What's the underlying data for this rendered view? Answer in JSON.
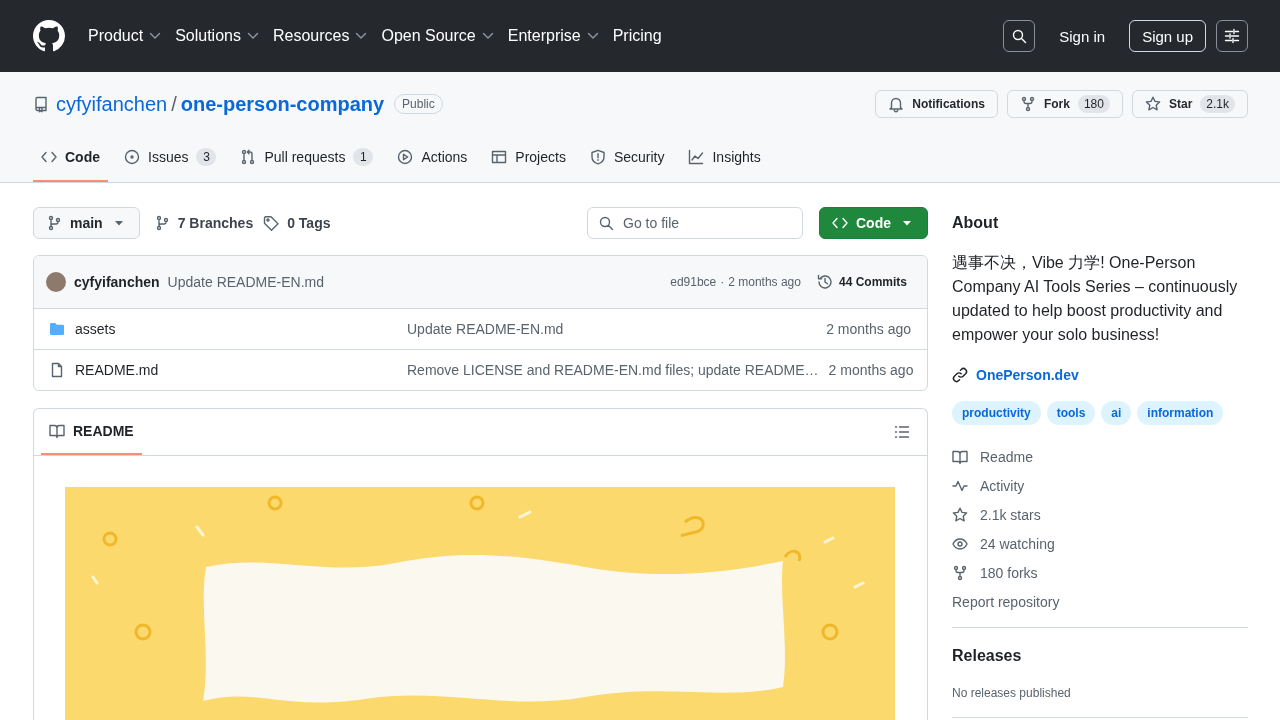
{
  "header": {
    "nav": [
      {
        "label": "Product",
        "dropdown": true
      },
      {
        "label": "Solutions",
        "dropdown": true
      },
      {
        "label": "Resources",
        "dropdown": true
      },
      {
        "label": "Open Source",
        "dropdown": true
      },
      {
        "label": "Enterprise",
        "dropdown": true
      },
      {
        "label": "Pricing",
        "dropdown": false
      }
    ],
    "sign_in": "Sign in",
    "sign_up": "Sign up"
  },
  "repo": {
    "owner": "cyfyifanchen",
    "separator": "/",
    "name": "one-person-company",
    "visibility": "Public",
    "actions": [
      {
        "kind": "notifications",
        "label": "Notifications"
      },
      {
        "kind": "fork",
        "label": "Fork",
        "count": "180"
      },
      {
        "kind": "star",
        "label": "Star",
        "count": "2.1k"
      }
    ]
  },
  "tabs": [
    {
      "kind": "code",
      "label": "Code",
      "selected": true
    },
    {
      "kind": "issues",
      "label": "Issues",
      "count": "3",
      "selected": false
    },
    {
      "kind": "pulls",
      "label": "Pull requests",
      "count": "1",
      "selected": false
    },
    {
      "kind": "actions",
      "label": "Actions",
      "selected": false
    },
    {
      "kind": "projects",
      "label": "Projects",
      "selected": false
    },
    {
      "kind": "security",
      "label": "Security",
      "selected": false
    },
    {
      "kind": "insights",
      "label": "Insights",
      "selected": false
    }
  ],
  "toolbar": {
    "branch": "main",
    "branches": "7 Branches",
    "tags": "0 Tags",
    "file_search": {
      "placeholder": "Go to file"
    },
    "code_button": "Code"
  },
  "latest_commit": {
    "author": "cyfyifanchen",
    "message": "Update README-EN.md",
    "hash": "ed91bce",
    "separator": "·",
    "age": "2 months ago",
    "commits": "44 Commits"
  },
  "files": [
    {
      "kind": "folder",
      "name": "assets",
      "message": "Update README-EN.md",
      "age": "2 months ago"
    },
    {
      "kind": "file",
      "name": "README.md",
      "message": "Remove LICENSE and README-EN.md files; update README…",
      "age": "2 months ago"
    }
  ],
  "readme": {
    "tab": "README"
  },
  "about": {
    "title": "About",
    "description": "遇事不决，Vibe 力学! One-Person Company AI Tools Series – continuously updated to help boost productivity and empower your solo business!",
    "website": "OnePerson.dev",
    "topics": [
      "productivity",
      "tools",
      "ai",
      "information"
    ],
    "links": [
      {
        "kind": "readme",
        "label": "Readme"
      },
      {
        "kind": "activity",
        "label": "Activity"
      },
      {
        "kind": "stars",
        "label": "2.1k stars"
      },
      {
        "kind": "watching",
        "label": "24 watching"
      },
      {
        "kind": "forks",
        "label": "180 forks"
      }
    ],
    "report": "Report repository"
  },
  "releases": {
    "title": "Releases",
    "note": "No releases published"
  }
}
